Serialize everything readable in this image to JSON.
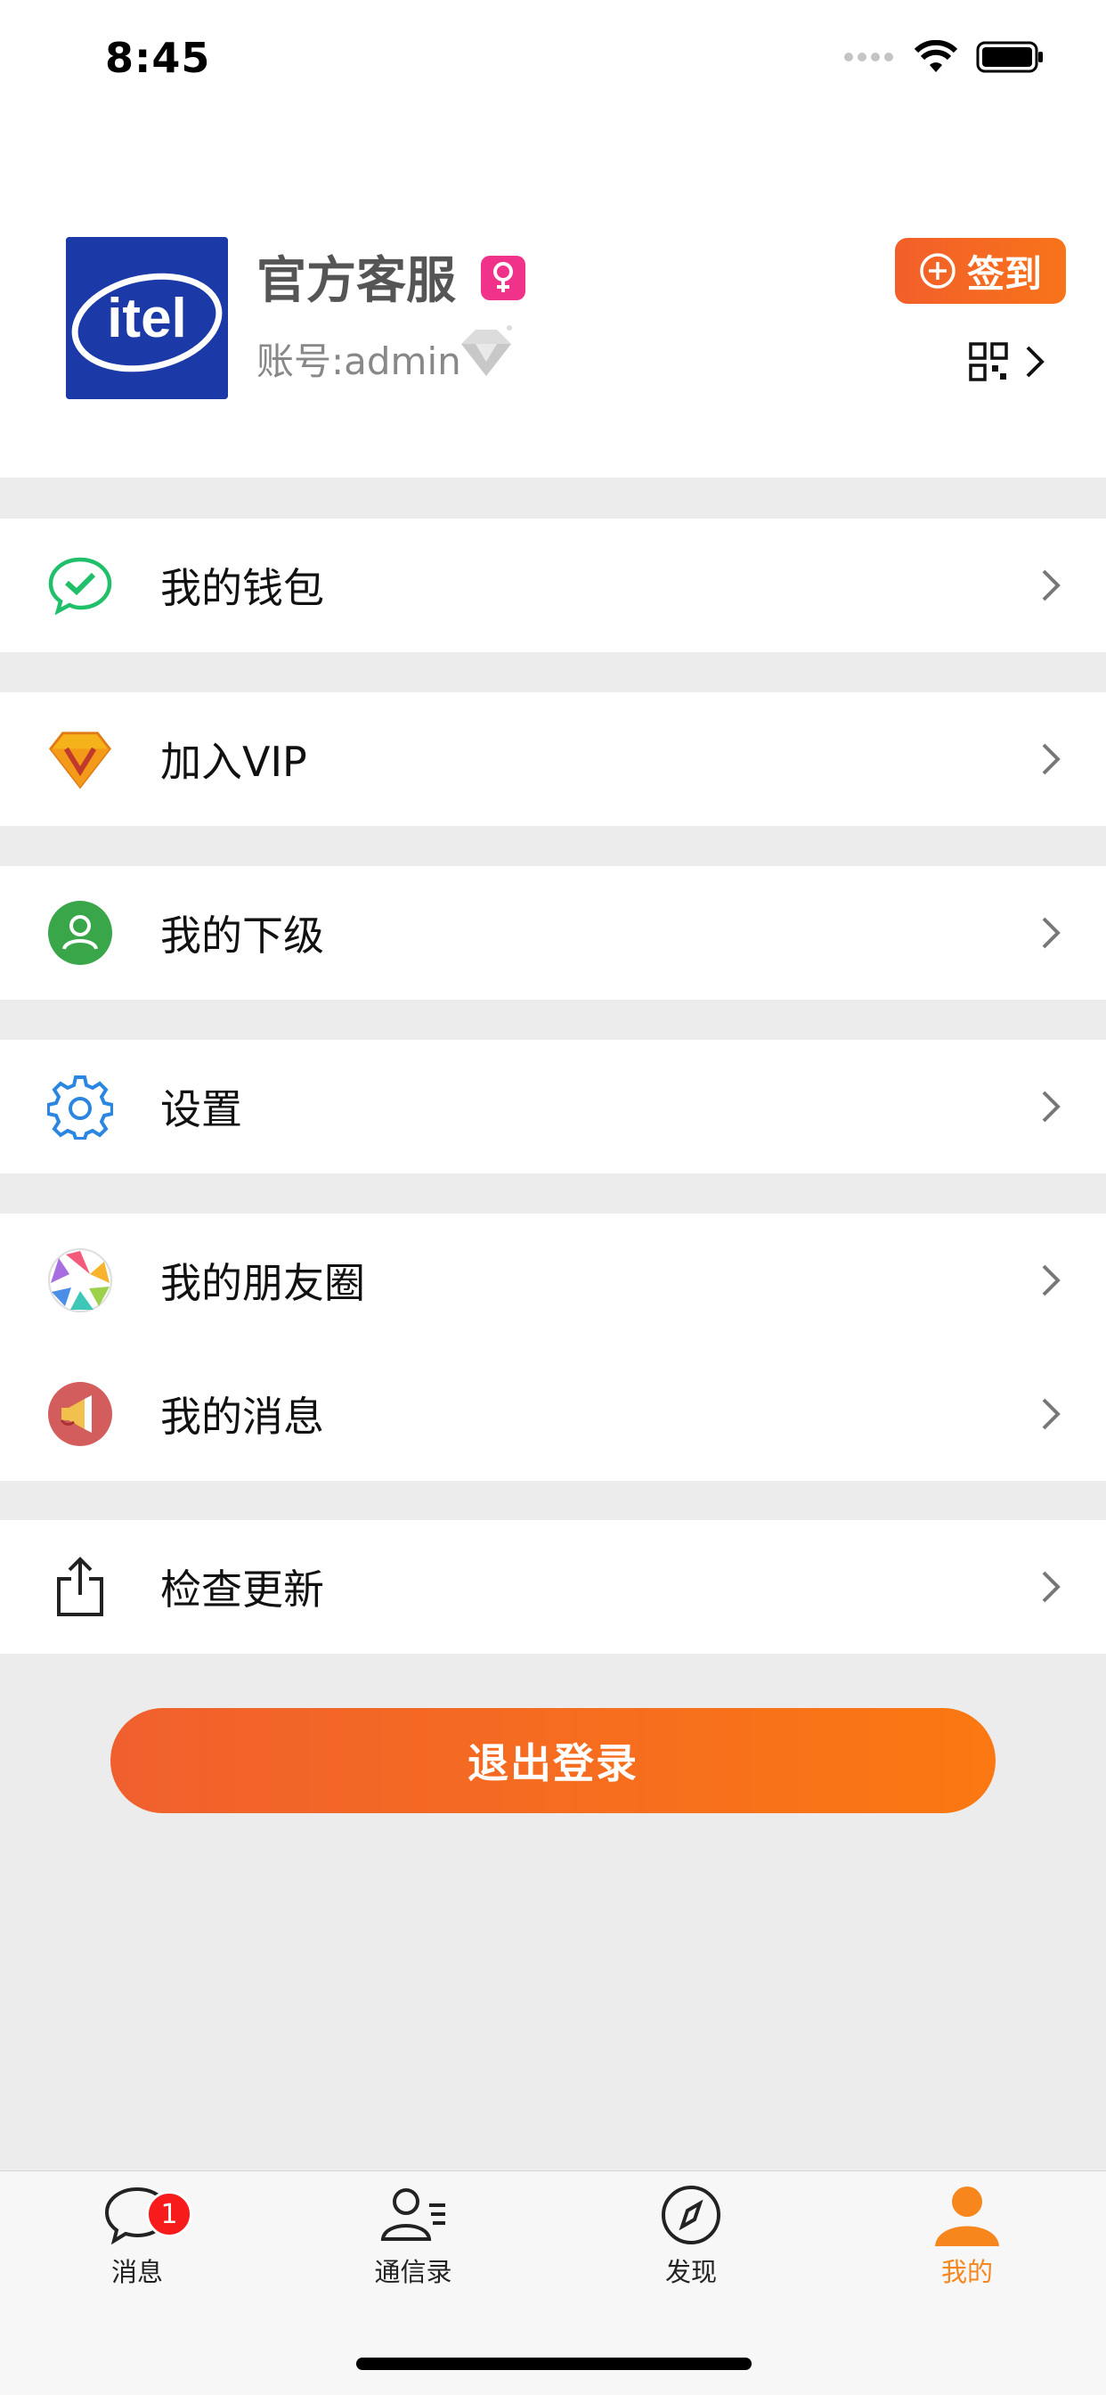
{
  "status": {
    "time": "8:45"
  },
  "profile": {
    "avatar_text": "itel",
    "name": "官方客服",
    "account": "账号:admin",
    "signin_label": "签到"
  },
  "menu": {
    "wallet": "我的钱包",
    "vip": "加入VIP",
    "subordinates": "我的下级",
    "settings": "设置",
    "moments": "我的朋友圈",
    "messages": "我的消息",
    "update": "检查更新"
  },
  "logout_label": "退出登录",
  "tabs": {
    "messages": {
      "label": "消息",
      "badge": "1"
    },
    "contacts": {
      "label": "通信录"
    },
    "discover": {
      "label": "发现"
    },
    "me": {
      "label": "我的"
    }
  },
  "colors": {
    "accent": "#f7861c",
    "signin_gradient_start": "#f25f2a",
    "gender_badge": "#f0328a"
  }
}
